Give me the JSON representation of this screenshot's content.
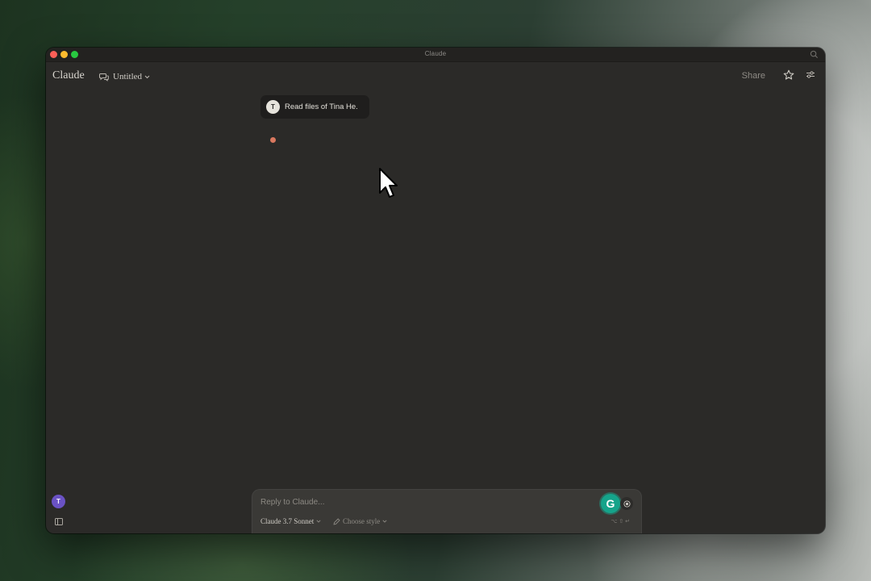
{
  "window": {
    "title": "Claude"
  },
  "header": {
    "brand": "Claude",
    "conversation_title": "Untitled",
    "share_label": "Share"
  },
  "message": {
    "avatar_initial": "T",
    "text": "Read files of Tina He."
  },
  "sidebar": {
    "user_initial": "T"
  },
  "composer": {
    "placeholder": "Reply to Claude...",
    "model": "Claude 3.7 Sonnet",
    "style": "Choose style",
    "grammarly_letter": "G",
    "shortcut": "⌥ ⇧ ↵"
  },
  "colors": {
    "window_bg": "#2b2a28",
    "user_bubble": "#1f1e1d",
    "thinking_dot": "#d9785f",
    "avatar": "#6a52c4",
    "grammarly": "#15a38a"
  }
}
